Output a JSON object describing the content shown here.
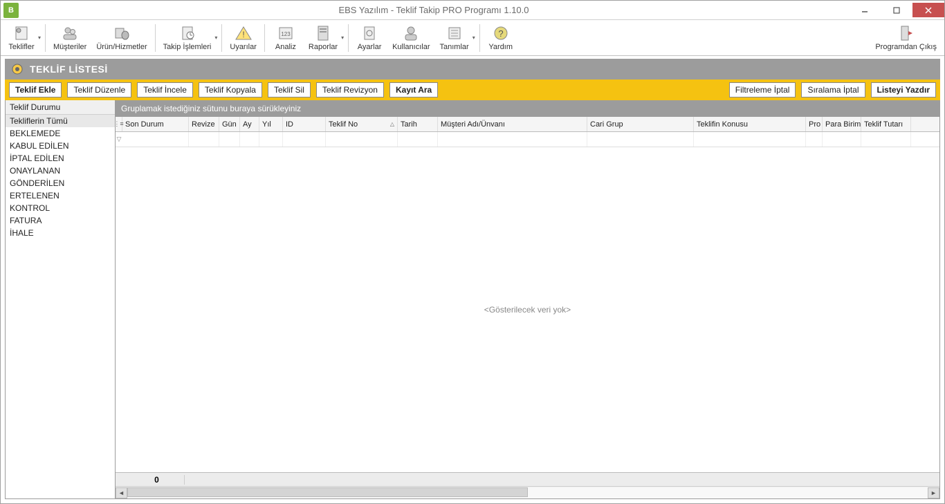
{
  "titlebar": {
    "icon_letter": "B",
    "title": "EBS Yazılım - Teklif Takip PRO Programı 1.10.0"
  },
  "main_toolbar": {
    "items": [
      {
        "label": "Teklifler",
        "icon": "gear-paper"
      },
      {
        "label": "Müşteriler",
        "icon": "people"
      },
      {
        "label": "Ürün/Hizmetler",
        "icon": "box-db"
      },
      {
        "label": "Takip İşlemleri",
        "icon": "clipboard-clock"
      },
      {
        "label": "Uyarılar",
        "icon": "warning"
      },
      {
        "label": "Analiz",
        "icon": "analytics"
      },
      {
        "label": "Raporlar",
        "icon": "report"
      },
      {
        "label": "Ayarlar",
        "icon": "settings"
      },
      {
        "label": "Kullanıcılar",
        "icon": "user"
      },
      {
        "label": "Tanımlar",
        "icon": "definitions"
      },
      {
        "label": "Yardım",
        "icon": "help"
      }
    ],
    "exit_label": "Programdan Çıkış"
  },
  "panel": {
    "title": "TEKLİF LİSTESİ"
  },
  "action_bar": {
    "left": [
      {
        "label": "Teklif Ekle",
        "bold": true
      },
      {
        "label": "Teklif Düzenle"
      },
      {
        "label": "Teklif İncele"
      },
      {
        "label": "Teklif Kopyala"
      },
      {
        "label": "Teklif Sil"
      },
      {
        "label": "Teklif Revizyon"
      },
      {
        "label": "Kayıt Ara",
        "bold": true
      }
    ],
    "right": [
      {
        "label": "Filtreleme İptal"
      },
      {
        "label": "Sıralama İptal"
      },
      {
        "label": "Listeyi Yazdır",
        "bold": true
      }
    ]
  },
  "sidebar": {
    "header": "Teklif Durumu",
    "items": [
      "Tekliflerin Tümü",
      "BEKLEMEDE",
      "KABUL EDİLEN",
      "İPTAL EDİLEN",
      "ONAYLANAN",
      "GÖNDERİLEN",
      "ERTELENEN",
      "KONTROL",
      "FATURA",
      "İHALE"
    ],
    "selected_index": 0
  },
  "grid": {
    "group_hint": "Gruplamak istediğiniz sütunu buraya sürükleyiniz",
    "columns": [
      {
        "label": "Son Durum",
        "cls": "c-son"
      },
      {
        "label": "Revize",
        "cls": "c-rev"
      },
      {
        "label": "Gün",
        "cls": "c-gun"
      },
      {
        "label": "Ay",
        "cls": "c-ay"
      },
      {
        "label": "Yıl",
        "cls": "c-yil"
      },
      {
        "label": "ID",
        "cls": "c-id"
      },
      {
        "label": "Teklif No",
        "cls": "c-tno",
        "sort": "asc"
      },
      {
        "label": "Tarih",
        "cls": "c-tar"
      },
      {
        "label": "Müşteri Adı/Ünvanı",
        "cls": "c-mus"
      },
      {
        "label": "Cari Grup",
        "cls": "c-cg"
      },
      {
        "label": "Teklifin Konusu",
        "cls": "c-tk"
      },
      {
        "label": "Pro",
        "cls": "c-pro"
      },
      {
        "label": "Para Birimi",
        "cls": "c-pb"
      },
      {
        "label": "Teklif Tutarı",
        "cls": "c-tt"
      }
    ],
    "empty_text": "<Gösterilecek veri yok>",
    "footer_count": "0"
  }
}
